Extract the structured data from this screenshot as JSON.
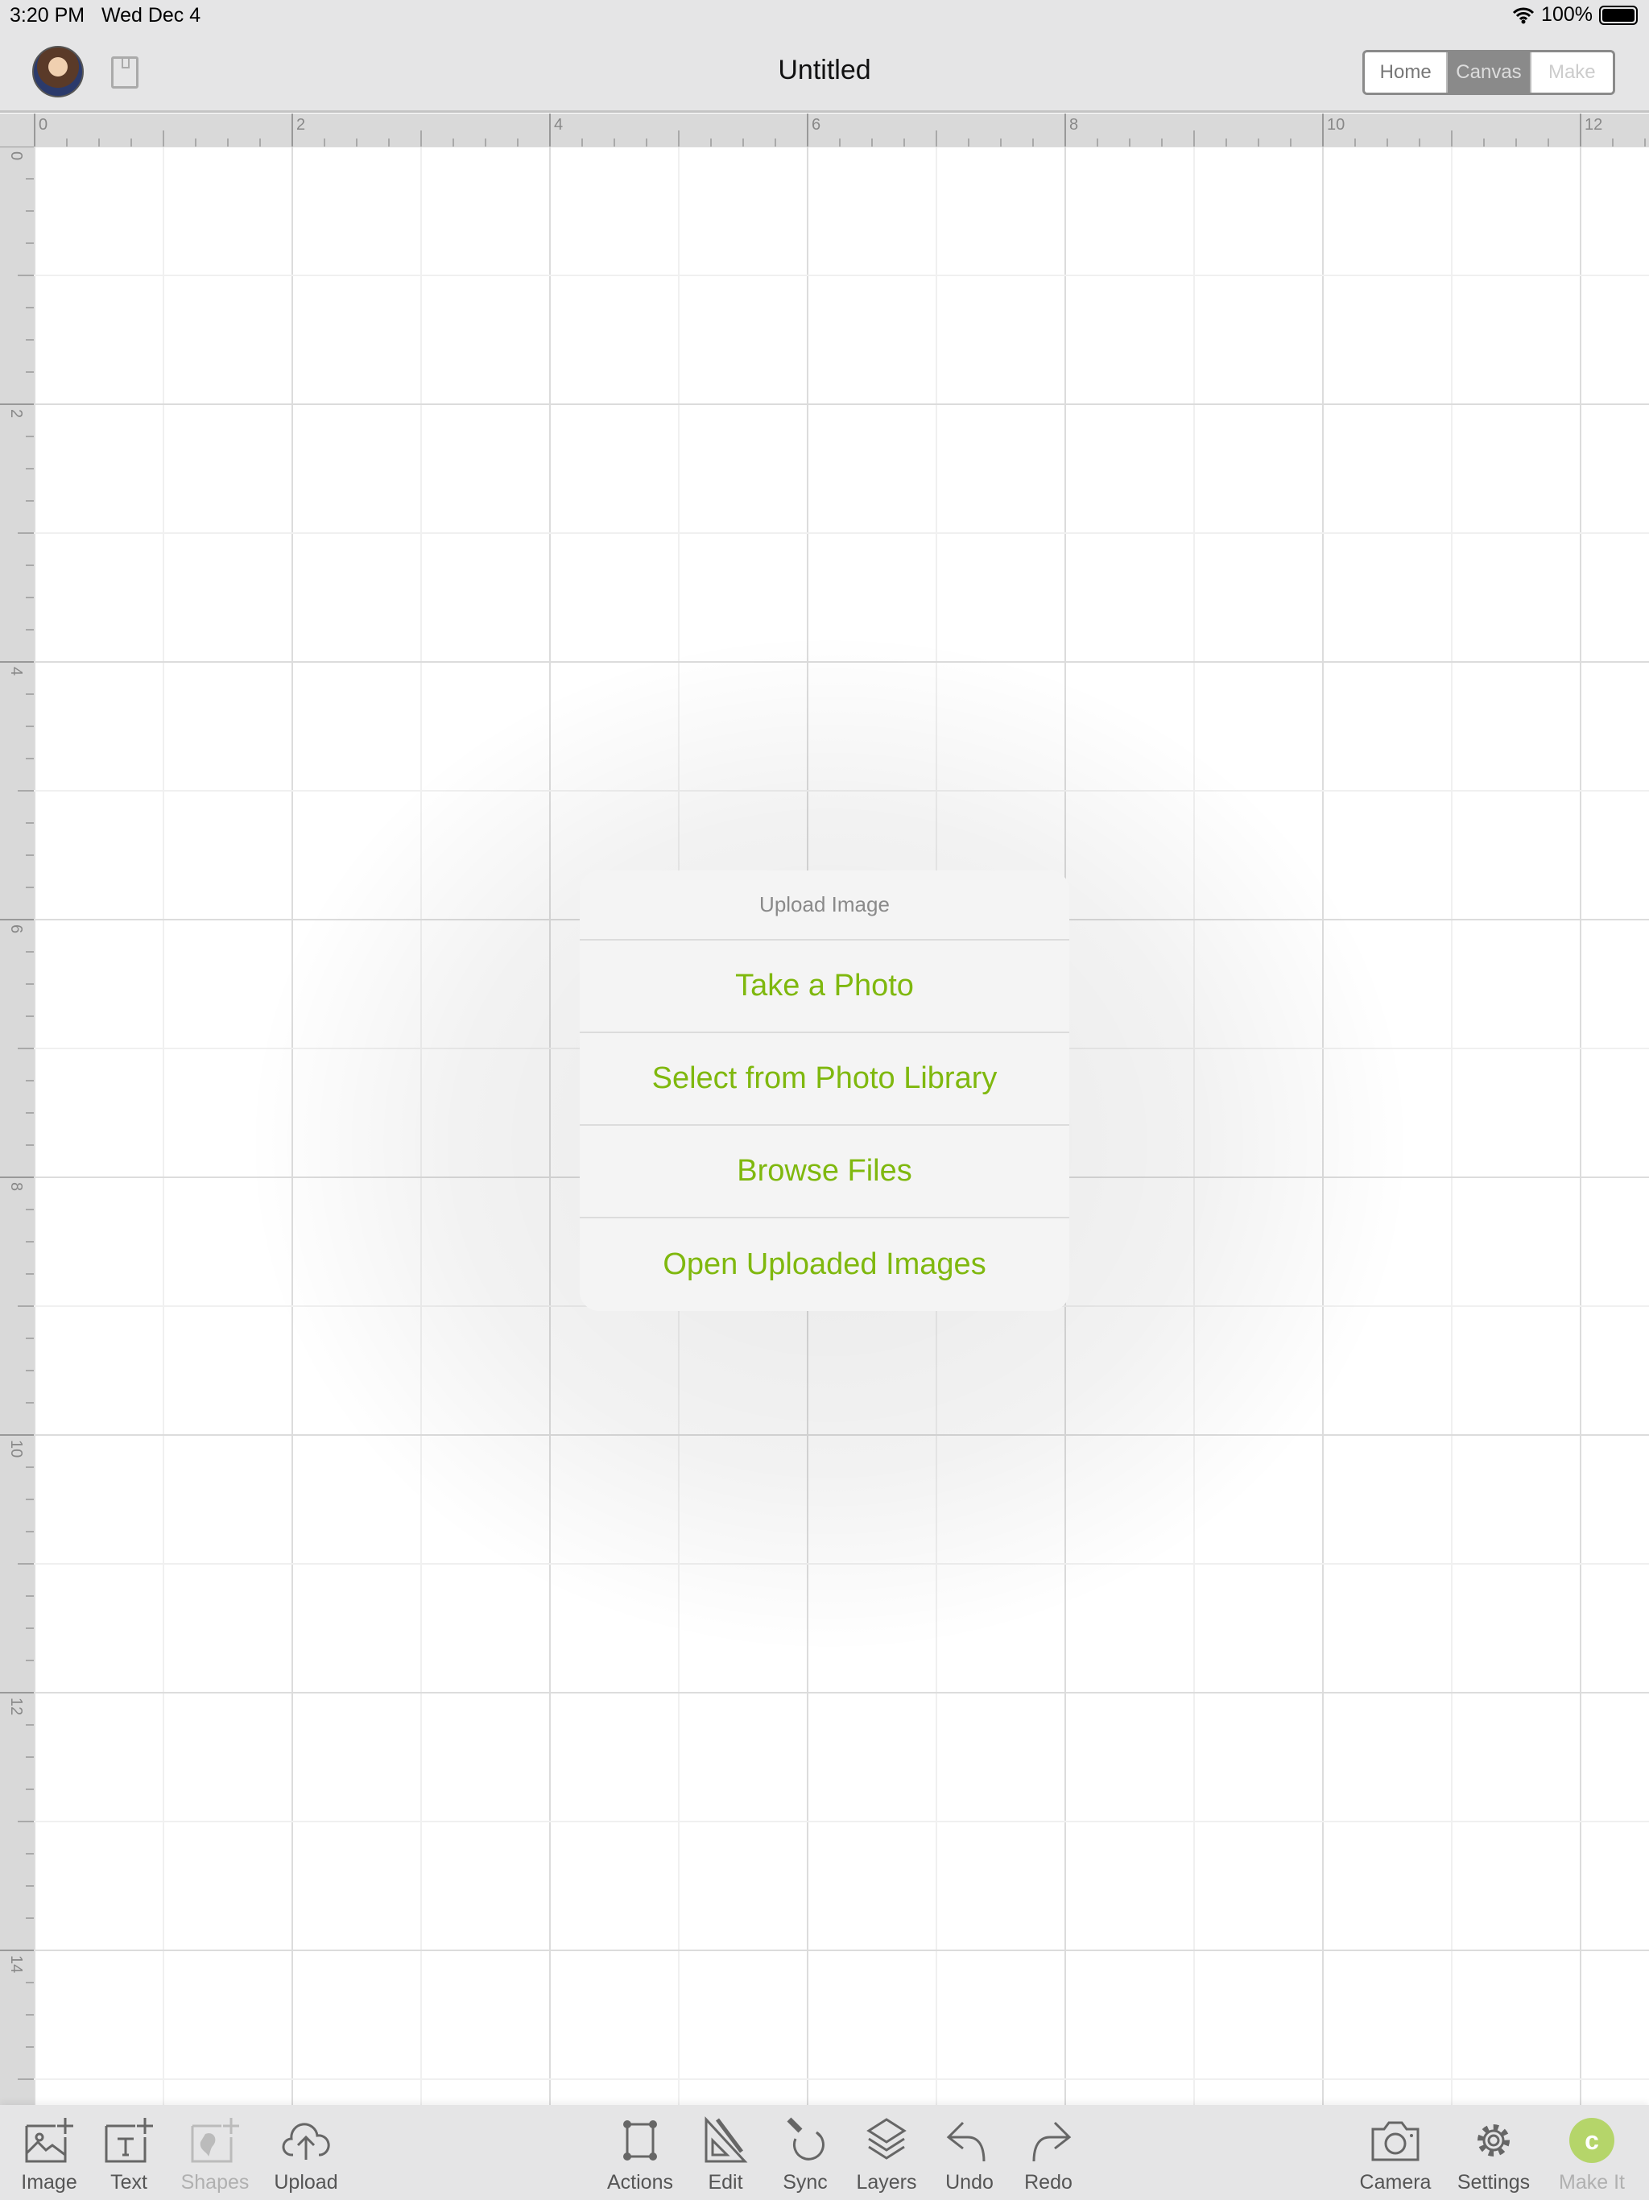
{
  "status_bar": {
    "time": "3:20 PM",
    "date": "Wed Dec 4",
    "battery": "100%",
    "battery_level": 1.0
  },
  "header": {
    "title": "Untitled",
    "nav": [
      {
        "label": "Home",
        "state": "normal"
      },
      {
        "label": "Canvas",
        "state": "active"
      },
      {
        "label": "Make",
        "state": "disabled"
      }
    ]
  },
  "rulers": {
    "top_labels": [
      "0",
      "2",
      "4",
      "6",
      "8",
      "10",
      "12"
    ],
    "left_labels": [
      "0",
      "2",
      "4",
      "6",
      "8",
      "10",
      "12",
      "14"
    ]
  },
  "dialog": {
    "title": "Upload Image",
    "options": [
      "Take a Photo",
      "Select from Photo Library",
      "Browse Files",
      "Open Uploaded Images"
    ],
    "accent_color": "#7fb80e"
  },
  "toolbar": {
    "left": [
      {
        "label": "Image",
        "icon": "image-add-icon"
      },
      {
        "label": "Text",
        "icon": "text-add-icon"
      },
      {
        "label": "Shapes",
        "icon": "shapes-add-icon",
        "disabled": true
      },
      {
        "label": "Upload",
        "icon": "cloud-upload-icon"
      }
    ],
    "center": [
      {
        "label": "Actions",
        "icon": "actions-icon"
      },
      {
        "label": "Edit",
        "icon": "edit-icon"
      },
      {
        "label": "Sync",
        "icon": "sync-icon"
      },
      {
        "label": "Layers",
        "icon": "layers-icon"
      },
      {
        "label": "Undo",
        "icon": "undo-icon"
      },
      {
        "label": "Redo",
        "icon": "redo-icon"
      }
    ],
    "right": [
      {
        "label": "Camera",
        "icon": "camera-icon"
      },
      {
        "label": "Settings",
        "icon": "gear-icon"
      },
      {
        "label": "Make It",
        "icon": "make-it-icon",
        "disabled": true,
        "icon_glyph": "c",
        "color": "#b5d56a"
      }
    ]
  }
}
